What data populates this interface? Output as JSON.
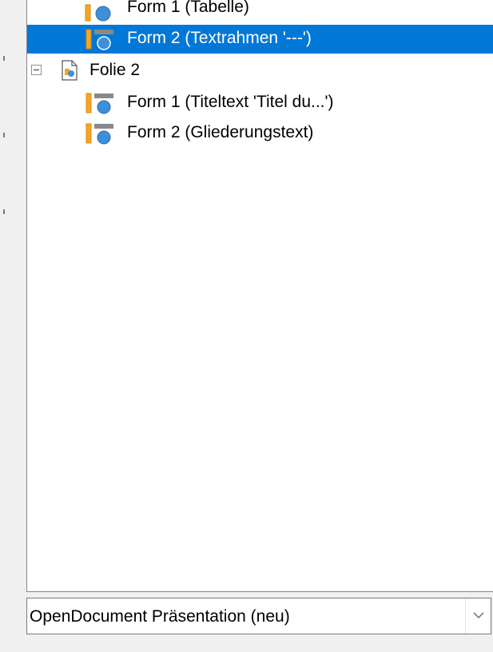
{
  "navigator": {
    "items": [
      {
        "label": "Form 1 (Tabelle)",
        "icon": "table-shape-icon",
        "selected": false
      },
      {
        "label": "Form 2 (Textrahmen '---')",
        "icon": "text-shape-icon",
        "selected": true
      },
      {
        "label": "Folie 2",
        "icon": "slide-icon",
        "selected": false,
        "expanded": true
      },
      {
        "label": "Form 1 (Titeltext 'Titel du...')",
        "icon": "text-shape-icon",
        "selected": false
      },
      {
        "label": "Form 2 (Gliederungstext)",
        "icon": "text-shape-icon",
        "selected": false
      }
    ]
  },
  "filter": {
    "selected": "OpenDocument Präsentation (neu)"
  },
  "colors": {
    "selection": "#0078d7",
    "shape_orange": "#f5a623",
    "shape_blue": "#3d8fd9",
    "shape_gray": "#8a8a8a"
  }
}
